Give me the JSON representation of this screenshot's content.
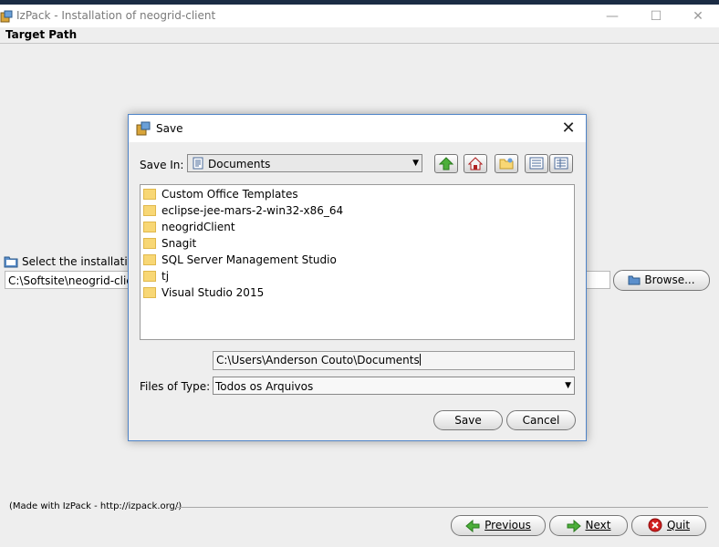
{
  "window": {
    "title": "IzPack - Installation of  neogrid-client",
    "minimize": "—",
    "maximize": "☐",
    "close": "✕"
  },
  "panel": {
    "header": "Target Path",
    "select_label": "Select the installation",
    "path_value": "C:\\Softsite\\neogrid-client",
    "browse_label": "Browse..."
  },
  "footer": {
    "credit": "(Made with IzPack - http://izpack.org/)",
    "previous": "Previous",
    "next": "Next",
    "quit": "Quit"
  },
  "dialog": {
    "title": "Save",
    "close": "✕",
    "save_in_label": "Save In:",
    "save_in_value": "Documents",
    "files": [
      "Custom Office Templates",
      "eclipse-jee-mars-2-win32-x86_64",
      "neogridClient",
      "Snagit",
      "SQL Server Management Studio",
      "tj",
      "Visual Studio 2015"
    ],
    "filename_value": "C:\\Users\\Anderson Couto\\Documents",
    "files_of_type_label": "Files of Type:",
    "files_of_type_value": "Todos os Arquivos",
    "save_button": "Save",
    "cancel_button": "Cancel"
  }
}
